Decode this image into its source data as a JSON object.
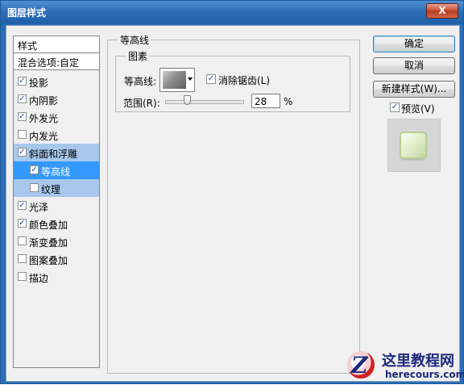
{
  "window": {
    "title": "图层样式",
    "close_label": "X"
  },
  "style_list": {
    "header": "样式",
    "blend_options": "混合选项:自定",
    "items": [
      {
        "label": "投影",
        "checked": "✓"
      },
      {
        "label": "内阴影",
        "checked": "✓"
      },
      {
        "label": "外发光",
        "checked": "✓"
      },
      {
        "label": "内发光",
        "checked": ""
      },
      {
        "label": "斜面和浮雕",
        "checked": "✓"
      },
      {
        "label": "等高线",
        "checked": "✓"
      },
      {
        "label": "纹理",
        "checked": ""
      },
      {
        "label": "光泽",
        "checked": "✓"
      },
      {
        "label": "颜色叠加",
        "checked": "✓"
      },
      {
        "label": "渐变叠加",
        "checked": ""
      },
      {
        "label": "图案叠加",
        "checked": ""
      },
      {
        "label": "描边",
        "checked": ""
      }
    ]
  },
  "contour_panel": {
    "group_title": "等高线",
    "subgroup_title": "图素",
    "contour_label": "等高线:",
    "antialias_label": "消除锯齿(L)",
    "antialias_checked": "✓",
    "range_label": "范围(R):",
    "range_value": "28",
    "range_unit": "%",
    "range_fraction": 0.28
  },
  "buttons": {
    "ok": "确定",
    "cancel": "取消",
    "new_style": "新建样式(W)...",
    "preview_label": "预览(V)",
    "preview_checked": "✓"
  },
  "watermark": {
    "title": "这里教程网",
    "url": "herecours.com"
  }
}
